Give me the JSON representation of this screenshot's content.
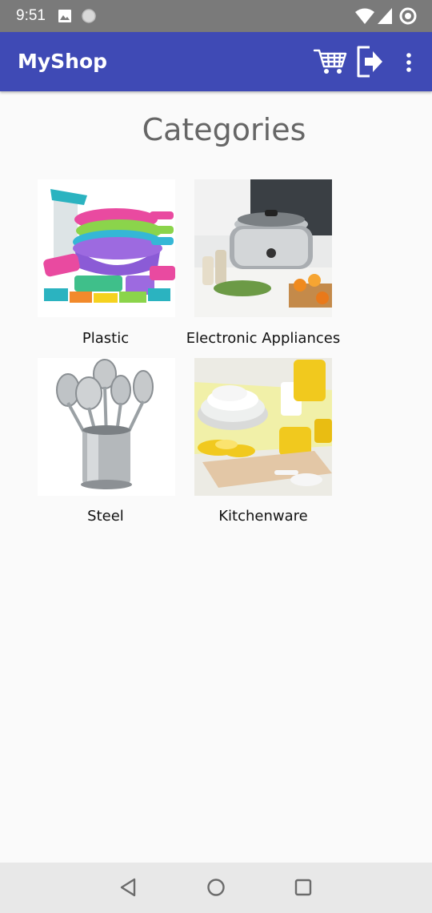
{
  "status_bar": {
    "time": "9:51",
    "icons": [
      "image-icon",
      "circle-icon",
      "wifi-icon",
      "signal-icon",
      "sync-icon"
    ]
  },
  "app_bar": {
    "title": "MyShop",
    "color": "#3f4ab5",
    "actions": [
      "cart-icon",
      "logout-icon",
      "more-vert-icon"
    ]
  },
  "main": {
    "title": "Categories",
    "categories": [
      {
        "label": "Plastic",
        "image": "plastic-products-image"
      },
      {
        "label": "Electronic Appliances",
        "image": "slow-cooker-image"
      },
      {
        "label": "Steel",
        "image": "steel-utensils-image"
      },
      {
        "label": "Kitchenware",
        "image": "kitchenware-bowls-image"
      }
    ]
  },
  "nav_bar": {
    "buttons": [
      "back-icon",
      "home-icon",
      "recents-icon"
    ]
  }
}
